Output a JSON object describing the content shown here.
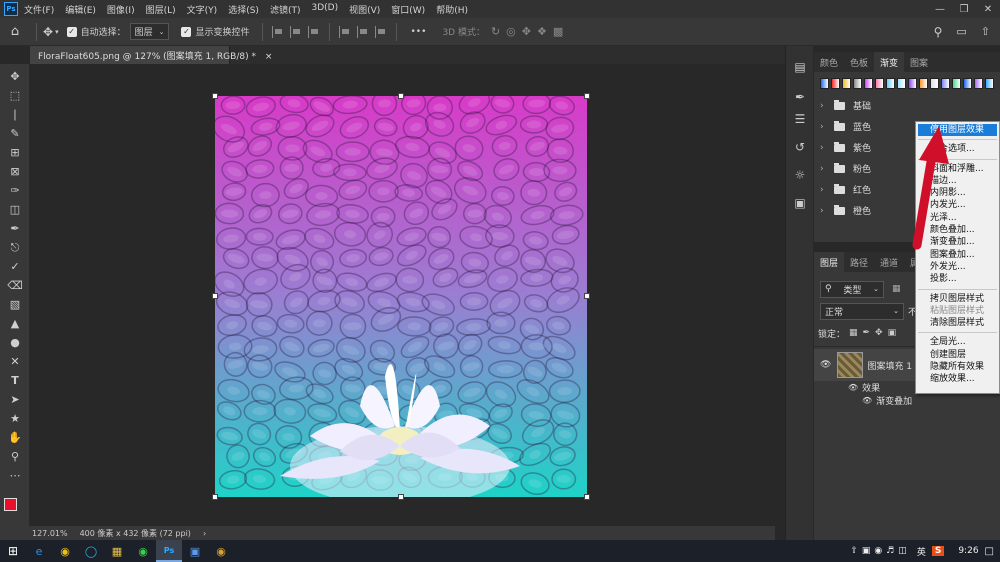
{
  "app": {
    "logo": "Ps"
  },
  "menubar": {
    "items": [
      "文件(F)",
      "编辑(E)",
      "图像(I)",
      "图层(L)",
      "文字(Y)",
      "选择(S)",
      "滤镜(T)",
      "3D(D)",
      "视图(V)",
      "窗口(W)",
      "帮助(H)"
    ]
  },
  "optionsbar": {
    "auto_select_label": "自动选择：",
    "auto_select_value": "图层",
    "show_transform_label": "显示变换控件",
    "mode_3d_label": "3D 模式：",
    "more": "•••"
  },
  "document": {
    "tab_title": "FloraFloat605.png @ 127% (图案填充 1, RGB/8) *",
    "close": "×"
  },
  "statusbar": {
    "zoom": "127.01%",
    "info": "400 像素 x 432 像素 (72 ppi)",
    "arrow": "›"
  },
  "gradient_panel": {
    "tabs": [
      "颜色",
      "色板",
      "渐变",
      "图案"
    ],
    "active_tab": "渐变",
    "swatch_colors": [
      "#1a6dff",
      "#ff2a2a",
      "#e8c020",
      "#8a8a8a",
      "#cc44ff",
      "#ff7aa8",
      "#66ccff",
      "#a0e0ff",
      "#8844ff",
      "#ff9933",
      "#ddddee",
      "#7788ff",
      "#44dd88",
      "#2266ee",
      "#aa66ff",
      "#33aaff"
    ],
    "folders": [
      "基础",
      "蓝色",
      "紫色",
      "粉色",
      "红色",
      "橙色"
    ]
  },
  "layers_panel": {
    "tabs": [
      "图层",
      "路径",
      "通道",
      "属"
    ],
    "filter_label": "类型",
    "blend_mode": "正常",
    "opacity_label": "不",
    "lock_label": "锁定：",
    "layer_name": "图案填充 1",
    "effects_label": "效果",
    "effect_item": "渐变叠加"
  },
  "context_menu": {
    "items": [
      {
        "label": "停用图层效果",
        "state": "highlighted"
      },
      {
        "sep": true
      },
      {
        "label": "混合选项...",
        "state": "normal"
      },
      {
        "sep": true
      },
      {
        "label": "斜面和浮雕...",
        "state": "normal"
      },
      {
        "label": "描边...",
        "state": "normal"
      },
      {
        "label": "内阴影...",
        "state": "normal"
      },
      {
        "label": "内发光...",
        "state": "normal"
      },
      {
        "label": "光泽...",
        "state": "normal"
      },
      {
        "label": "颜色叠加...",
        "state": "normal"
      },
      {
        "label": "渐变叠加...",
        "state": "normal"
      },
      {
        "label": "图案叠加...",
        "state": "normal"
      },
      {
        "label": "外发光...",
        "state": "normal"
      },
      {
        "label": "投影...",
        "state": "normal"
      },
      {
        "sep": true
      },
      {
        "label": "拷贝图层样式",
        "state": "normal"
      },
      {
        "label": "粘贴图层样式",
        "state": "disabled"
      },
      {
        "label": "清除图层样式",
        "state": "normal"
      },
      {
        "sep": true
      },
      {
        "label": "全局光...",
        "state": "normal"
      },
      {
        "label": "创建图层",
        "state": "normal"
      },
      {
        "label": "隐藏所有效果",
        "state": "normal"
      },
      {
        "label": "缩放效果...",
        "state": "normal"
      }
    ]
  },
  "taskbar": {
    "ime": "英",
    "time": "9:26"
  },
  "colors": {
    "foreground": "#e8102a",
    "background": "#000000",
    "gradient_top": "#d83ac8",
    "gradient_bottom": "#1ed3c7",
    "arrow": "#d0102a"
  }
}
